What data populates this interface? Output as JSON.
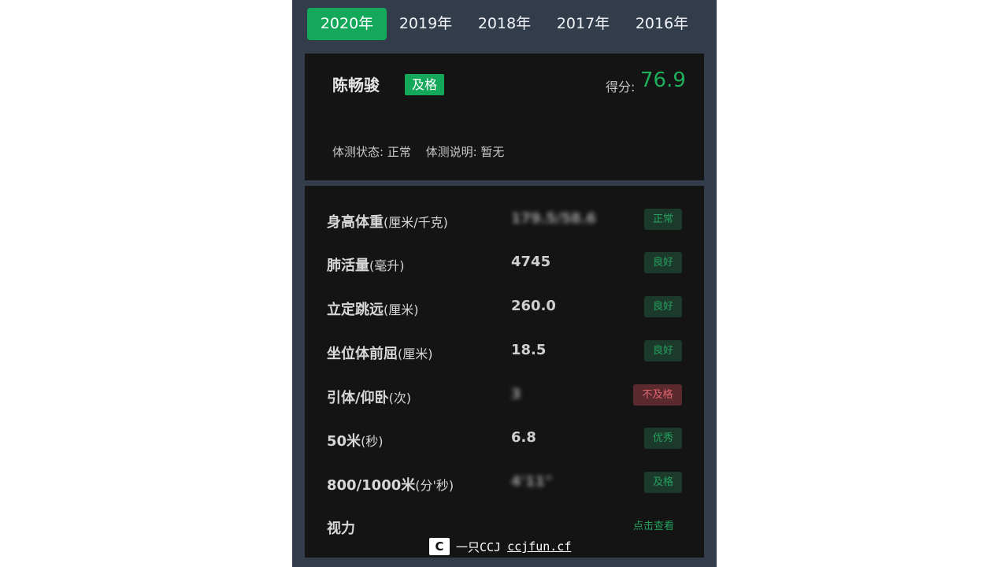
{
  "year_tabs": [
    {
      "label": "2020年",
      "active": true
    },
    {
      "label": "2019年",
      "active": false
    },
    {
      "label": "2018年",
      "active": false
    },
    {
      "label": "2017年",
      "active": false
    },
    {
      "label": "2016年",
      "active": false
    }
  ],
  "summary": {
    "name": "陈畅骏",
    "grade": "及格",
    "score_label": "得分:",
    "score": "76.9",
    "status_label": "体测状态: 正常",
    "note_label": "体测说明: 暂无"
  },
  "items": [
    {
      "name": "身高体重",
      "unit": "(厘米/千克)",
      "value": "179.5/58.6",
      "value_blurred": true,
      "badge": "正常",
      "badge_type": "good"
    },
    {
      "name": "肺活量",
      "unit": "(毫升)",
      "value": "4745",
      "value_blurred": false,
      "badge": "良好",
      "badge_type": "good"
    },
    {
      "name": "立定跳远",
      "unit": "(厘米)",
      "value": "260.0",
      "value_blurred": false,
      "badge": "良好",
      "badge_type": "good"
    },
    {
      "name": "坐位体前屈",
      "unit": "(厘米)",
      "value": "18.5",
      "value_blurred": false,
      "badge": "良好",
      "badge_type": "good"
    },
    {
      "name": "引体/仰卧",
      "unit": "(次)",
      "value": "3",
      "value_blurred": true,
      "badge": "不及格",
      "badge_type": "fail"
    },
    {
      "name": "50米",
      "unit": "(秒)",
      "value": "6.8",
      "value_blurred": false,
      "badge": "优秀",
      "badge_type": "good"
    },
    {
      "name": "800/1000米",
      "unit": "(分'秒)",
      "value": "4'11\"",
      "value_blurred": true,
      "badge": "及格",
      "badge_type": "good"
    },
    {
      "name": "视力",
      "unit": "",
      "value": "",
      "value_blurred": false,
      "link": "点击查看"
    }
  ],
  "watermark": {
    "logo_text": "C",
    "text": "一只CCJ",
    "url": "ccjfun.cf"
  },
  "colors": {
    "accent_green": "#14a85a",
    "fail_red": "#e26470",
    "background": "#323c4b",
    "card": "#141414"
  }
}
